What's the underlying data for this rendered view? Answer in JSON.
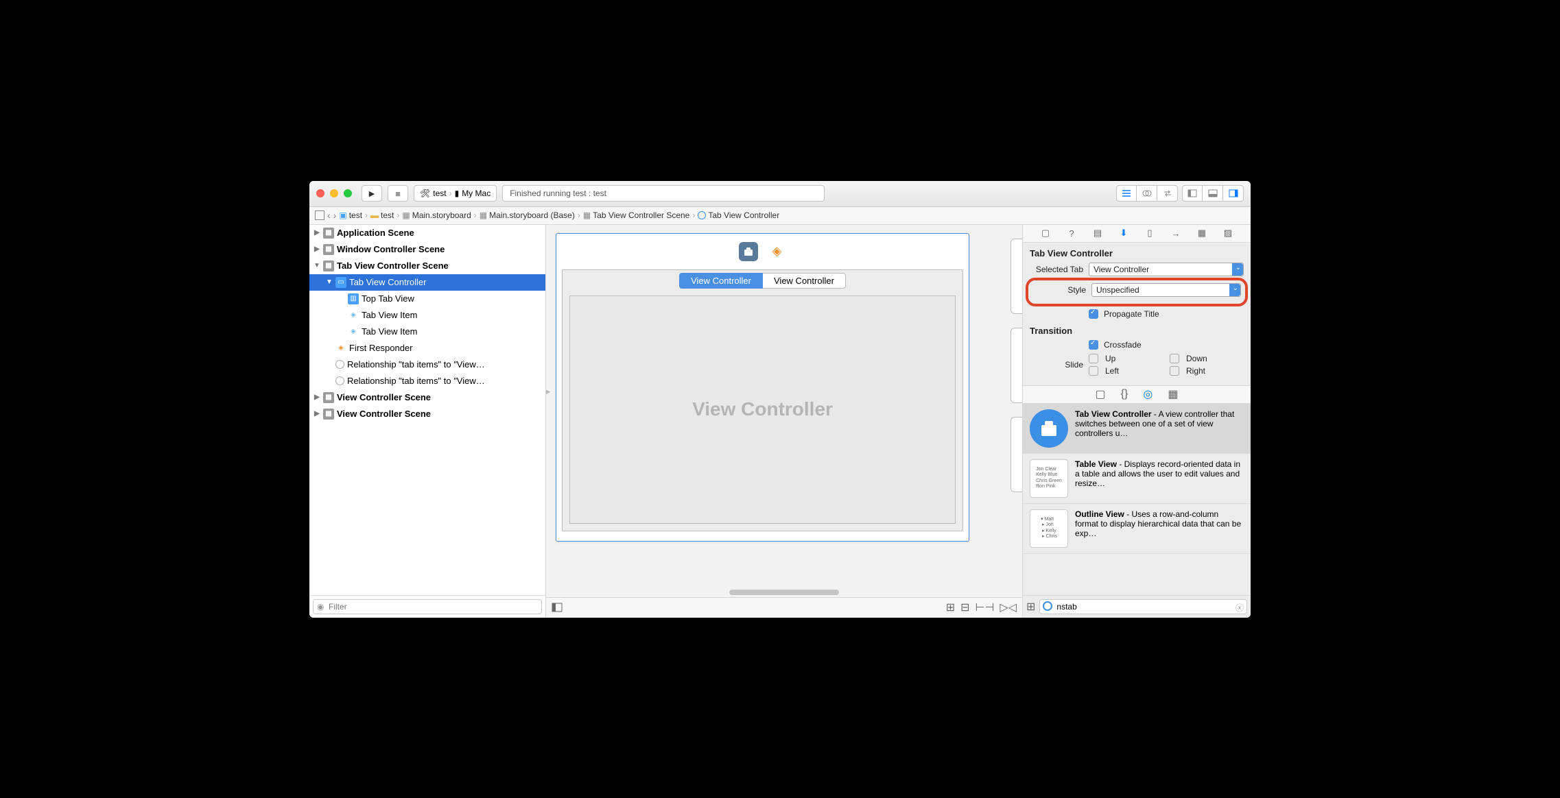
{
  "toolbar": {
    "scheme_name": "test",
    "destination": "My Mac",
    "status": "Finished running test : test"
  },
  "jumpbar": {
    "items": [
      "test",
      "test",
      "Main.storyboard",
      "Main.storyboard (Base)",
      "Tab View Controller Scene",
      "Tab View Controller"
    ]
  },
  "outline": {
    "app_scene": "Application Scene",
    "win_scene": "Window Controller Scene",
    "tab_scene": "Tab View Controller Scene",
    "tab_ctrl": "Tab View Controller",
    "top_tab": "Top Tab View",
    "tab_item1": "Tab View Item",
    "tab_item2": "Tab View Item",
    "first_resp": "First Responder",
    "rel1": "Relationship \"tab items\" to \"View…",
    "rel2": "Relationship \"tab items\" to \"View…",
    "vc_scene1": "View Controller Scene",
    "vc_scene2": "View Controller Scene",
    "filter_placeholder": "Filter"
  },
  "canvas": {
    "tab1": "View Controller",
    "tab2": "View Controller",
    "placeholder": "View Controller"
  },
  "inspector": {
    "section": "Tab View Controller",
    "selected_tab_label": "Selected Tab",
    "selected_tab_value": "View Controller",
    "style_label": "Style",
    "style_value": "Unspecified",
    "propagate": "Propagate Title",
    "transition": "Transition",
    "crossfade": "Crossfade",
    "slide": "Slide",
    "up": "Up",
    "down": "Down",
    "left": "Left",
    "right": "Right"
  },
  "library": {
    "items": [
      {
        "title": "Tab View Controller",
        "desc": " - A view controller that switches between one of a set of view controllers u…"
      },
      {
        "title": "Table View",
        "desc": " - Displays record-oriented data in a table and allows the user to edit values and resize…"
      },
      {
        "title": "Outline View",
        "desc": " - Uses a row-and-column format to display hierarchical data that can be exp…"
      }
    ],
    "table_preview": "Jon Clear\nKelly Blue\nChris Green\nRon Pink",
    "outline_preview": "▾ Matt\n ▸ Jon\n ▸ Kelly\n ▸ Chris",
    "search_value": "nstab"
  }
}
